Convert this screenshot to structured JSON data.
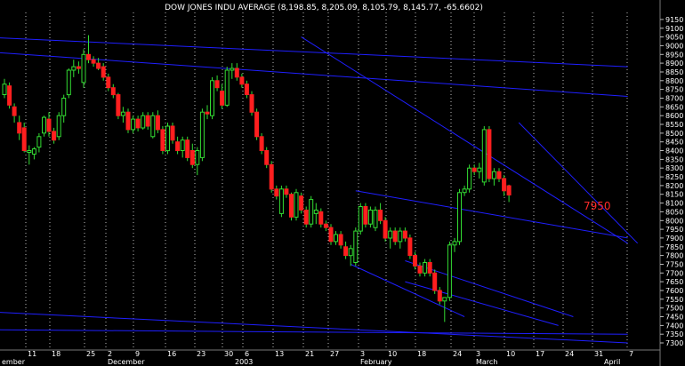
{
  "chart_data": {
    "type": "candlestick",
    "title": "DOW JONES INDU AVERAGE (8,198.85, 8,205.09, 8,105.79, 8,145.77, -65.6602)",
    "ylim": [
      7275,
      9200
    ],
    "y_ticks": [
      9150,
      9100,
      9050,
      9000,
      8950,
      8900,
      8850,
      8800,
      8750,
      8700,
      8650,
      8600,
      8550,
      8500,
      8450,
      8400,
      8350,
      8300,
      8250,
      8200,
      8150,
      8100,
      8050,
      8000,
      7950,
      7900,
      7850,
      7800,
      7750,
      7700,
      7650,
      7600,
      7550,
      7500,
      7450,
      7400,
      7350,
      7300
    ],
    "x_tick_labels": [
      "11",
      "18",
      "25",
      "2",
      "9",
      "16",
      "23",
      "30",
      "6",
      "13",
      "21",
      "27",
      "3",
      "10",
      "18",
      "24",
      "3",
      "10",
      "17",
      "24",
      "31",
      "7"
    ],
    "month_labels": [
      "ember",
      "December",
      "2003",
      "February",
      "March",
      "April"
    ],
    "annotation": "7950",
    "grid": "vertical dotted",
    "colors": {
      "background": "#000000",
      "up": "#33dd33",
      "down": "#ff1f1f",
      "wick": "#33dd33",
      "trendline": "#1f1fff",
      "grid": "#bbbbbb",
      "text": "#ffffff",
      "annotation": "#ff2a2a"
    },
    "candles": [
      [
        0,
        8720,
        8810,
        8700,
        8780
      ],
      [
        1,
        8770,
        8790,
        8640,
        8660
      ],
      [
        2,
        8650,
        8670,
        8560,
        8600
      ],
      [
        3,
        8560,
        8600,
        8460,
        8500
      ],
      [
        4,
        8530,
        8560,
        8390,
        8400
      ],
      [
        5,
        8390,
        8430,
        8320,
        8400
      ],
      [
        6,
        8380,
        8420,
        8350,
        8410
      ],
      [
        7,
        8420,
        8500,
        8390,
        8480
      ],
      [
        8,
        8500,
        8600,
        8480,
        8590
      ],
      [
        9,
        8580,
        8620,
        8480,
        8510
      ],
      [
        10,
        8510,
        8530,
        8440,
        8460
      ],
      [
        11,
        8480,
        8620,
        8460,
        8600
      ],
      [
        12,
        8600,
        8720,
        8560,
        8700
      ],
      [
        13,
        8720,
        8870,
        8700,
        8860
      ],
      [
        14,
        8860,
        8920,
        8820,
        8880
      ],
      [
        15,
        8880,
        8910,
        8840,
        8870
      ],
      [
        16,
        8790,
        8980,
        8760,
        8950
      ],
      [
        17,
        8950,
        9060,
        8900,
        8920
      ],
      [
        18,
        8920,
        8940,
        8880,
        8900
      ],
      [
        19,
        8900,
        8930,
        8860,
        8870
      ],
      [
        20,
        8880,
        8900,
        8800,
        8820
      ],
      [
        21,
        8820,
        8840,
        8740,
        8760
      ],
      [
        22,
        8760,
        8780,
        8700,
        8720
      ],
      [
        23,
        8720,
        8730,
        8580,
        8600
      ],
      [
        24,
        8600,
        8650,
        8560,
        8620
      ],
      [
        25,
        8620,
        8640,
        8500,
        8520
      ],
      [
        26,
        8520,
        8600,
        8500,
        8580
      ],
      [
        27,
        8580,
        8600,
        8510,
        8530
      ],
      [
        28,
        8530,
        8620,
        8520,
        8600
      ],
      [
        29,
        8600,
        8620,
        8520,
        8540
      ],
      [
        30,
        8480,
        8620,
        8470,
        8600
      ],
      [
        31,
        8600,
        8630,
        8500,
        8520
      ],
      [
        32,
        8520,
        8540,
        8380,
        8400
      ],
      [
        33,
        8400,
        8560,
        8380,
        8540
      ],
      [
        34,
        8540,
        8560,
        8440,
        8460
      ],
      [
        35,
        8450,
        8480,
        8380,
        8400
      ],
      [
        36,
        8400,
        8480,
        8360,
        8460
      ],
      [
        37,
        8460,
        8480,
        8340,
        8360
      ],
      [
        38,
        8400,
        8440,
        8300,
        8320
      ],
      [
        39,
        8320,
        8420,
        8260,
        8400
      ],
      [
        40,
        8360,
        8640,
        8340,
        8620
      ],
      [
        41,
        8620,
        8660,
        8580,
        8610
      ],
      [
        42,
        8600,
        8820,
        8580,
        8800
      ],
      [
        43,
        8800,
        8830,
        8740,
        8760
      ],
      [
        44,
        8740,
        8780,
        8640,
        8660
      ],
      [
        45,
        8660,
        8880,
        8650,
        8860
      ],
      [
        46,
        8860,
        8900,
        8810,
        8870
      ],
      [
        47,
        8870,
        8900,
        8800,
        8820
      ],
      [
        48,
        8820,
        8840,
        8760,
        8780
      ],
      [
        49,
        8780,
        8800,
        8700,
        8720
      ],
      [
        50,
        8720,
        8740,
        8600,
        8620
      ],
      [
        51,
        8620,
        8640,
        8460,
        8480
      ],
      [
        52,
        8480,
        8500,
        8380,
        8400
      ],
      [
        53,
        8400,
        8420,
        8300,
        8320
      ],
      [
        54,
        8320,
        8340,
        8160,
        8180
      ],
      [
        55,
        8180,
        8200,
        8120,
        8140
      ],
      [
        56,
        8040,
        8200,
        8020,
        8180
      ],
      [
        57,
        8180,
        8200,
        8130,
        8150
      ],
      [
        58,
        8150,
        8160,
        8000,
        8020
      ],
      [
        59,
        8020,
        8180,
        8000,
        8160
      ],
      [
        60,
        8140,
        8160,
        8040,
        8060
      ],
      [
        61,
        8060,
        8080,
        7960,
        7980
      ],
      [
        62,
        7980,
        8140,
        7960,
        8120
      ],
      [
        63,
        8040,
        8100,
        7980,
        8060
      ],
      [
        64,
        8050,
        8070,
        7960,
        7980
      ],
      [
        65,
        7980,
        8000,
        7940,
        7960
      ],
      [
        66,
        7960,
        7980,
        7860,
        7880
      ],
      [
        67,
        7880,
        7940,
        7860,
        7920
      ],
      [
        68,
        7920,
        7940,
        7840,
        7860
      ],
      [
        69,
        7850,
        7880,
        7780,
        7800
      ],
      [
        70,
        7800,
        7860,
        7740,
        7840
      ],
      [
        71,
        7760,
        7960,
        7740,
        7940
      ],
      [
        72,
        7940,
        8100,
        7920,
        8080
      ],
      [
        73,
        8080,
        8100,
        7960,
        7980
      ],
      [
        74,
        7980,
        8080,
        7960,
        8060
      ],
      [
        75,
        7960,
        8080,
        7940,
        8060
      ],
      [
        76,
        8060,
        8100,
        7980,
        8000
      ],
      [
        77,
        8000,
        8020,
        7880,
        7900
      ],
      [
        78,
        7900,
        7960,
        7840,
        7940
      ],
      [
        79,
        7940,
        7960,
        7860,
        7880
      ],
      [
        80,
        7880,
        7960,
        7840,
        7940
      ],
      [
        81,
        7940,
        7960,
        7880,
        7900
      ],
      [
        82,
        7900,
        7920,
        7780,
        7800
      ],
      [
        83,
        7800,
        7820,
        7720,
        7740
      ],
      [
        84,
        7740,
        7760,
        7680,
        7700
      ],
      [
        85,
        7700,
        7780,
        7680,
        7760
      ],
      [
        86,
        7760,
        7780,
        7680,
        7700
      ],
      [
        87,
        7700,
        7720,
        7580,
        7600
      ],
      [
        88,
        7600,
        7620,
        7520,
        7540
      ],
      [
        89,
        7540,
        7560,
        7420,
        7560
      ],
      [
        90,
        7560,
        7880,
        7540,
        7860
      ],
      [
        91,
        7860,
        7900,
        7820,
        7880
      ],
      [
        92,
        7880,
        8180,
        7860,
        8160
      ],
      [
        93,
        8160,
        8200,
        8140,
        8180
      ],
      [
        94,
        8180,
        8320,
        8160,
        8300
      ],
      [
        95,
        8300,
        8320,
        8260,
        8280
      ],
      [
        96,
        8280,
        8330,
        8240,
        8300
      ],
      [
        97,
        8220,
        8540,
        8200,
        8520
      ],
      [
        98,
        8520,
        8540,
        8220,
        8240
      ],
      [
        99,
        8240,
        8300,
        8200,
        8280
      ],
      [
        100,
        8280,
        8300,
        8220,
        8240
      ],
      [
        101,
        8240,
        8260,
        8140,
        8170
      ],
      [
        102,
        8198.85,
        8205.09,
        8105.79,
        8145.77
      ]
    ]
  }
}
